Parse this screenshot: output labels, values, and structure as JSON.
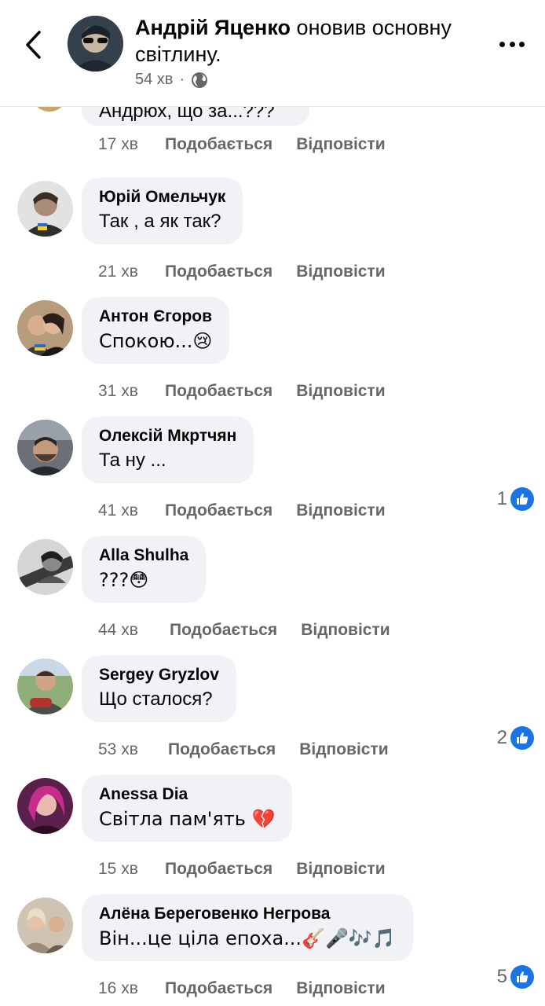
{
  "header": {
    "author": "Андрій Яценко",
    "action": "оновив основну світлину.",
    "time": "54 хв",
    "separator": "·"
  },
  "partial_comment": {
    "text": "Андрюх, що за...???",
    "time": "17 хв"
  },
  "labels": {
    "like": "Подобається",
    "reply": "Відповісти"
  },
  "comments": [
    {
      "name": "Юрій Омельчук",
      "text": "Так , а як так?",
      "time": "21 хв",
      "reactions": ""
    },
    {
      "name": "Антон Єгоров",
      "text": "Спокою...😢",
      "time": "31 хв",
      "reactions": ""
    },
    {
      "name": "Олексій Мкртчян",
      "text": "Та ну ...",
      "time": "41 хв",
      "reactions": "1"
    },
    {
      "name": "Alla Shulha",
      "text": "???😳",
      "time": "44 хв",
      "reactions": ""
    },
    {
      "name": "Sergey Gryzlov",
      "text": "Що сталося?",
      "time": "53 хв",
      "reactions": "2"
    },
    {
      "name": "Anessa Dia",
      "text": "Світла пам'ять 💔",
      "time": "15 хв",
      "reactions": ""
    },
    {
      "name": "Алёна Береговенко Негрова",
      "text": "Він...це ціла епоха...🎸🎤🎶🎵",
      "time": "16 хв",
      "reactions": "5"
    }
  ],
  "colors": {
    "bubble": "#f0f2f5",
    "like_blue": "#1b74e4",
    "meta": "#65676b"
  },
  "icons": {
    "back": "chevron-left-icon",
    "more": "more-horizontal-icon",
    "audience": "globe-icon",
    "reaction": "like-icon"
  }
}
